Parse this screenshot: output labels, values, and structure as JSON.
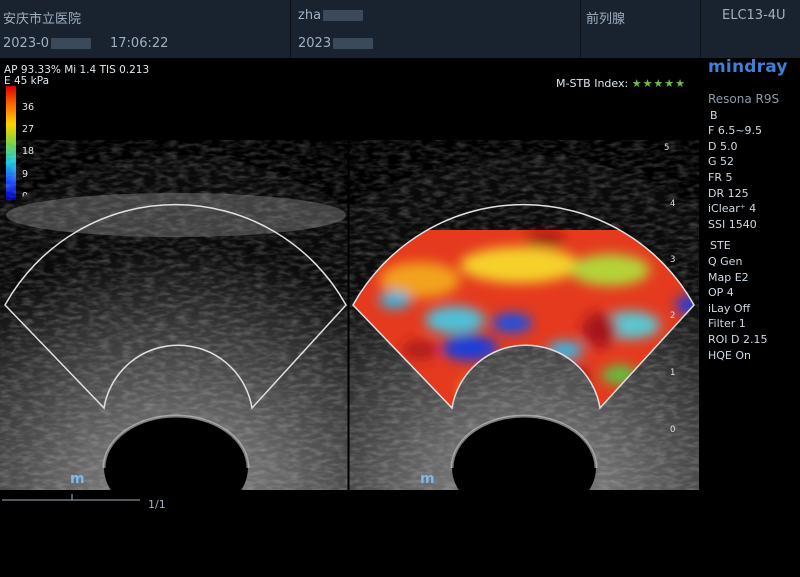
{
  "header": {
    "hospital": "安庆市立医院",
    "patient": "zha",
    "organ": "前列腺",
    "probe": "ELC13-4U",
    "date": "2023-0",
    "time": "17:06:22",
    "patient_id": "2023"
  },
  "elasto": {
    "left_info": "AP 93.33%  Mi 1.4  TIS 0.213",
    "scale_unit": "E 45 kPa",
    "scale_ticks": [
      "36",
      "27",
      "18",
      "9",
      "0"
    ],
    "stb_label": "M-STB Index:",
    "stb_stars": "★★★★★",
    "stb_value": 5
  },
  "brand": {
    "logo": "mindray",
    "model": "Resona R9S"
  },
  "params": {
    "b_mode": {
      "title": "B",
      "items": [
        "F 6.5~9.5",
        "D 5.0",
        "G 52",
        "FR 5",
        "DR 125",
        "iClear⁺ 4",
        "SSI 1540"
      ]
    },
    "ste_mode": {
      "title": "STE",
      "items": [
        "Q Gen",
        "Map E2",
        "OP 4",
        "iLay Off",
        "Filter 1",
        "ROI D 2.15",
        "HQE On"
      ]
    }
  },
  "depth_scale": [
    "5",
    "4",
    "3",
    "2",
    "1",
    "0"
  ],
  "frame": "1/1",
  "probe_marker": "m"
}
